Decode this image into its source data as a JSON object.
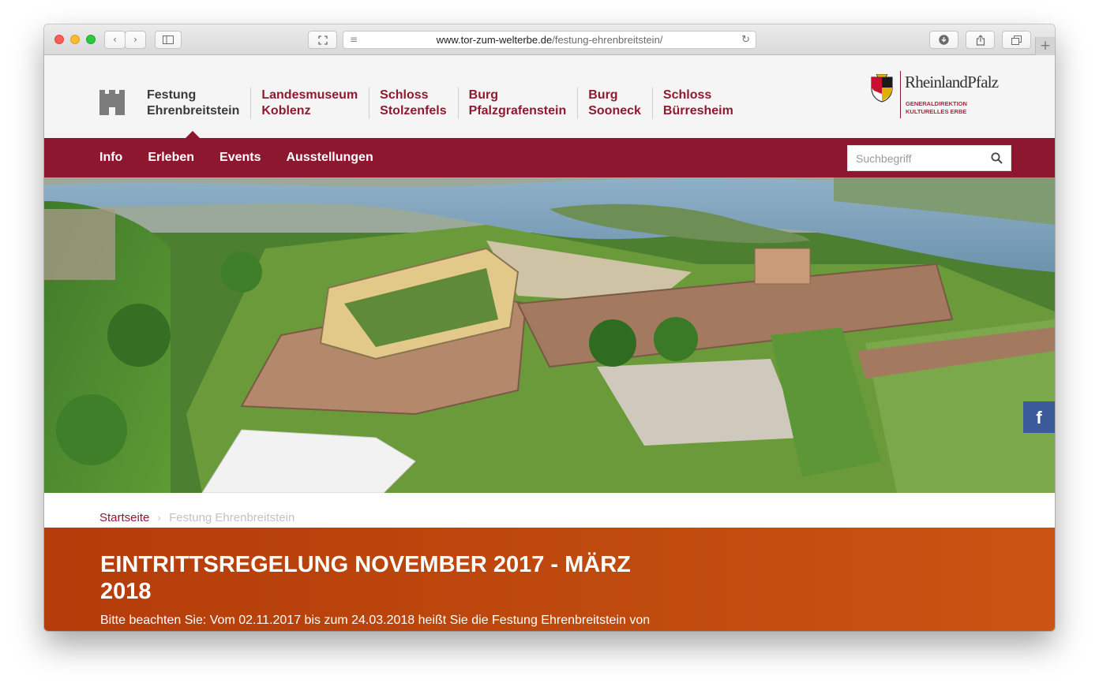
{
  "browser": {
    "url_host": "www.tor-zum-welterbe.de",
    "url_path": "/festung-ehrenbreitstein/",
    "back_icon": "chevron-left-icon",
    "forward_icon": "chevron-right-icon"
  },
  "header": {
    "sites": [
      {
        "line1": "Festung",
        "line2": "Ehrenbreitstein"
      },
      {
        "line1": "Landesmuseum",
        "line2": "Koblenz"
      },
      {
        "line1": "Schloss",
        "line2": "Stolzenfels"
      },
      {
        "line1": "Burg",
        "line2": "Pfalzgrafenstein"
      },
      {
        "line1": "Burg",
        "line2": "Sooneck"
      },
      {
        "line1": "Schloss",
        "line2": "Bürresheim"
      }
    ],
    "logo": {
      "name": "RheinlandPfalz",
      "sub1": "GENERALDIREKTION",
      "sub2": "KULTURELLES ERBE"
    }
  },
  "nav": {
    "items": [
      "Info",
      "Erleben",
      "Events",
      "Ausstellungen"
    ],
    "search_placeholder": "Suchbegriff"
  },
  "social": {
    "facebook_label": "f"
  },
  "breadcrumb": {
    "home": "Startseite",
    "separator": "›",
    "current": "Festung Ehrenbreitstein"
  },
  "notice": {
    "title": "EINTRITTSREGELUNG NOVEMBER 2017 - MÄRZ 2018",
    "text": "Bitte beachten Sie: Vom 02.11.2017 bis zum 24.03.2018 heißt Sie die Festung Ehrenbreitstein von"
  },
  "colors": {
    "brand": "#8e1730",
    "notice": "#c04b0e",
    "facebook": "#3b5a9a"
  }
}
